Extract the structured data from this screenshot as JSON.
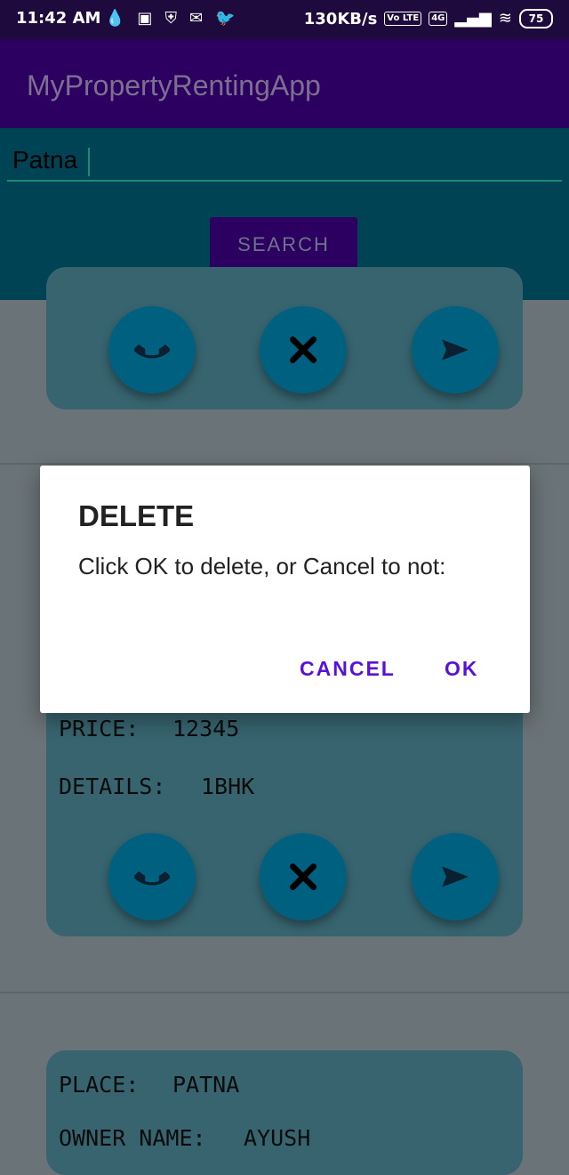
{
  "status_bar": {
    "time": "11:42 AM",
    "net_speed": "130KB/s",
    "volte": "Vo LTE",
    "network": "4G",
    "battery": "75"
  },
  "app_bar": {
    "title": "MyPropertyRentingApp"
  },
  "search": {
    "value": "Patna",
    "button_label": "SEARCH"
  },
  "cards": [
    {
      "id": "card-1"
    },
    {
      "price_label": "PRICE:",
      "price": "12345",
      "details_label": "DETAILS:",
      "details": "1BHK"
    },
    {
      "place_label": "PLACE:",
      "place": "PATNA",
      "owner_label": "OWNER NAME:",
      "owner": "AYUSH"
    }
  ],
  "dialog": {
    "title": "DELETE",
    "message": "Click OK to delete, or Cancel to not:",
    "cancel_label": "CANCEL",
    "ok_label": "OK"
  },
  "colors": {
    "app_bar": "#2c0060",
    "search_area": "#004354",
    "accent": "#5a10d6",
    "fab": "#006080"
  }
}
